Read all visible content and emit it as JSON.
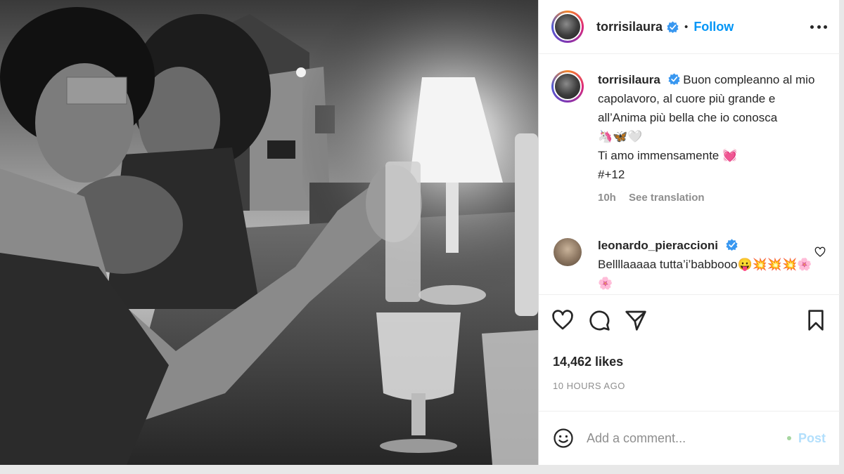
{
  "post": {
    "photo_alt": "black and white photo",
    "username": "torrisilaura",
    "follow_label": "Follow",
    "separator": "•",
    "more_icon": "more-horizontal-icon"
  },
  "caption": {
    "username": "torrisilaura",
    "line1": "Buon compleanno al mio capolavoro, al cuore più grande e all’Anima più bella che io conosca",
    "emoji": "🦄🦋🤍",
    "line2": "Ti amo immensamente 💓",
    "line3": "#+12",
    "time": "10h",
    "see_translation": "See translation"
  },
  "comment": {
    "username": "leonardo_pieraccioni",
    "text": "Bellllaaaaa tutta’i’babbooo😛💥💥💥🌸🌸"
  },
  "actions": {
    "like_icon": "heart-icon",
    "comment_icon": "comment-icon",
    "share_icon": "send-icon",
    "save_icon": "bookmark-icon"
  },
  "stats": {
    "likes": "14,462 likes",
    "time_ago": "10 HOURS AGO"
  },
  "add_comment": {
    "placeholder": "Add a comment...",
    "post_label": "Post"
  },
  "colors": {
    "accent": "#0095f6",
    "post_disabled": "#b2dffc"
  }
}
